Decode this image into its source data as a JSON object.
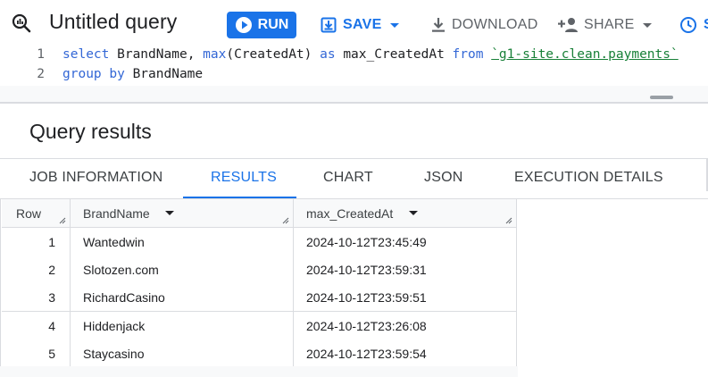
{
  "header": {
    "title": "Untitled query",
    "run_label": "RUN",
    "save_label": "SAVE",
    "download_label": "DOWNLOAD",
    "share_label": "SHARE",
    "schedule_label": "S"
  },
  "editor": {
    "lines": [
      {
        "number": "1",
        "tokens": [
          {
            "t": "select",
            "c": "kw"
          },
          {
            "t": " BrandName, ",
            "c": "plain"
          },
          {
            "t": "max",
            "c": "fn"
          },
          {
            "t": "(CreatedAt) ",
            "c": "plain"
          },
          {
            "t": "as",
            "c": "kw"
          },
          {
            "t": " max_CreatedAt ",
            "c": "plain"
          },
          {
            "t": "from",
            "c": "kw"
          },
          {
            "t": " ",
            "c": "plain"
          },
          {
            "t": "`g1-site.clean.payments`",
            "c": "str"
          }
        ]
      },
      {
        "number": "2",
        "tokens": [
          {
            "t": "group by",
            "c": "kw"
          },
          {
            "t": " BrandName",
            "c": "plain"
          }
        ]
      }
    ]
  },
  "results": {
    "heading": "Query results",
    "tabs": [
      {
        "label": "JOB INFORMATION",
        "active": false
      },
      {
        "label": "RESULTS",
        "active": true
      },
      {
        "label": "CHART",
        "active": false
      },
      {
        "label": "JSON",
        "active": false
      },
      {
        "label": "EXECUTION DETAILS",
        "active": false
      }
    ],
    "columns": [
      "Row",
      "BrandName",
      "max_CreatedAt"
    ],
    "rows": [
      [
        "1",
        "Wantedwin",
        "2024-10-12T23:45:49"
      ],
      [
        "2",
        "Slotozen.com",
        "2024-10-12T23:59:31"
      ],
      [
        "3",
        "RichardCasino",
        "2024-10-12T23:59:51"
      ],
      [
        "4",
        "Hiddenjack",
        "2024-10-12T23:26:08"
      ],
      [
        "5",
        "Staycasino",
        "2024-10-12T23:59:54"
      ]
    ]
  },
  "colors": {
    "accent": "#1a73e8",
    "keyword": "#3367d6",
    "string": "#188038"
  }
}
